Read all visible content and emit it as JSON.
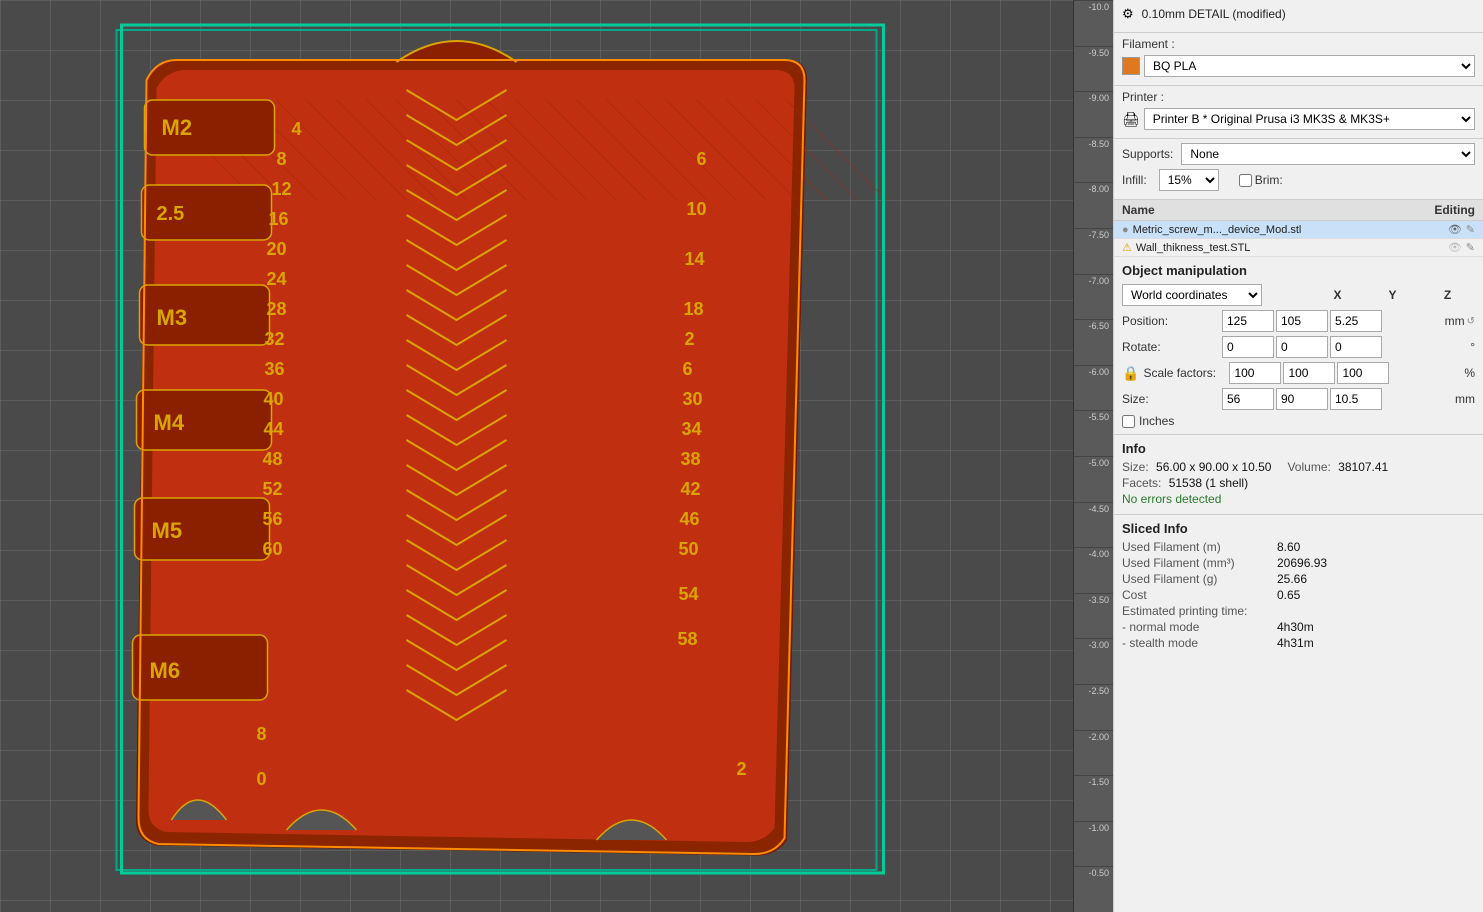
{
  "viewport": {
    "ruler_marks": [
      "-10.0",
      "-9.50",
      "-9.00",
      "-8.50",
      "-8.00",
      "-7.50",
      "-7.00",
      "-6.50",
      "-6.00",
      "-5.50",
      "-5.00",
      "-4.50",
      "-4.00",
      "-3.50",
      "-3.00",
      "-2.50",
      "-2.00",
      "-1.50",
      "-1.00",
      "-0.50"
    ]
  },
  "right_panel": {
    "config_label": "0.10mm DETAIL (modified)",
    "filament_label": "Filament :",
    "filament_color": "#e07820",
    "filament_name": "BQ PLA",
    "printer_label": "Printer :",
    "printer_name": "Printer B * Original Prusa i3 MK3S & MK3S+",
    "supports_label": "Supports:",
    "supports_value": "None",
    "infill_label": "Infill:",
    "infill_value": "15%",
    "brim_label": "Brim:",
    "brim_checked": false,
    "object_list": {
      "col_name": "Name",
      "col_editing": "Editing",
      "objects": [
        {
          "name": "Metric_screw_m..._device_Mod.stl",
          "selected": true,
          "visible": true,
          "has_warning": false
        },
        {
          "name": "Wall_thikness_test.STL",
          "selected": false,
          "visible": false,
          "has_warning": true
        }
      ]
    },
    "object_manipulation": {
      "title": "Object manipulation",
      "coord_system": "World coordinates",
      "x_label": "X",
      "y_label": "Y",
      "z_label": "Z",
      "position_label": "Position:",
      "position_x": "125",
      "position_y": "105",
      "position_z": "5.25",
      "position_unit": "mm",
      "rotate_label": "Rotate:",
      "rotate_x": "0",
      "rotate_y": "0",
      "rotate_z": "0",
      "rotate_unit": "°",
      "scale_label": "Scale factors:",
      "scale_x": "100",
      "scale_y": "100",
      "scale_z": "100",
      "scale_unit": "%",
      "size_label": "Size:",
      "size_x": "56",
      "size_y": "90",
      "size_z": "10.5",
      "size_unit": "mm",
      "inches_label": "Inches"
    },
    "info": {
      "title": "Info",
      "size_label": "Size:",
      "size_value": "56.00 x 90.00 x 10.50",
      "volume_label": "Volume:",
      "volume_value": "38107.41",
      "facets_label": "Facets:",
      "facets_value": "51538 (1 shell)",
      "no_errors": "No errors detected"
    },
    "sliced_info": {
      "title": "Sliced Info",
      "rows": [
        {
          "key": "Used Filament (m)",
          "value": "8.60"
        },
        {
          "key": "Used Filament (mm³)",
          "value": "20696.93"
        },
        {
          "key": "Used Filament (g)",
          "value": "25.66"
        },
        {
          "key": "Cost",
          "value": "0.65"
        },
        {
          "key": "Estimated printing time:",
          "value": ""
        },
        {
          "key": "  - normal mode",
          "value": "4h30m"
        },
        {
          "key": "  - stealth mode",
          "value": "4h31m"
        }
      ]
    }
  }
}
